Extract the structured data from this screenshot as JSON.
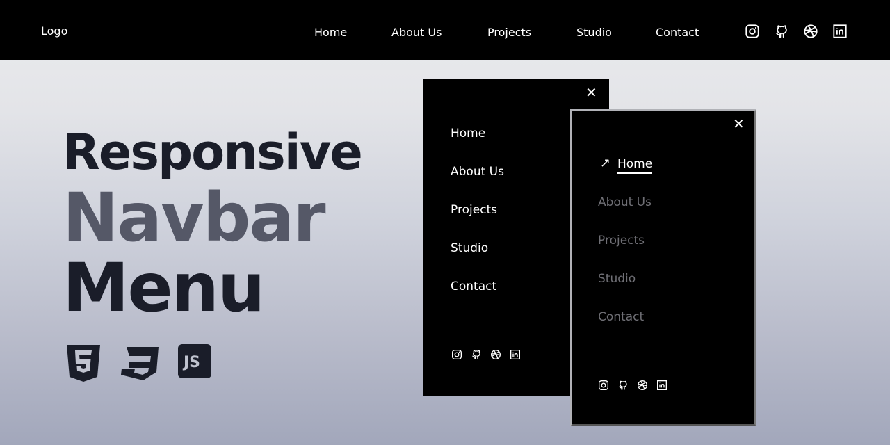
{
  "header": {
    "logo": "Logo",
    "nav": [
      "Home",
      "About Us",
      "Projects",
      "Studio",
      "Contact"
    ],
    "social_icons": [
      "instagram-icon",
      "github-icon",
      "dribbble-icon",
      "linkedin-icon"
    ]
  },
  "hero": {
    "line1": "Responsive",
    "line2": "Navbar",
    "line3": "Menu",
    "tech_icons": [
      "html5-icon",
      "css3-icon",
      "js-icon"
    ],
    "js_label": "JS"
  },
  "menu1": {
    "items": [
      "Home",
      "About Us",
      "Projects",
      "Studio",
      "Contact"
    ]
  },
  "menu2": {
    "items": [
      "Home",
      "About Us",
      "Projects",
      "Studio",
      "Contact"
    ],
    "active": "Home"
  },
  "colors": {
    "title_dark": "#1a1d29",
    "title_gray": "#555867",
    "inactive": "#6f6f75"
  }
}
